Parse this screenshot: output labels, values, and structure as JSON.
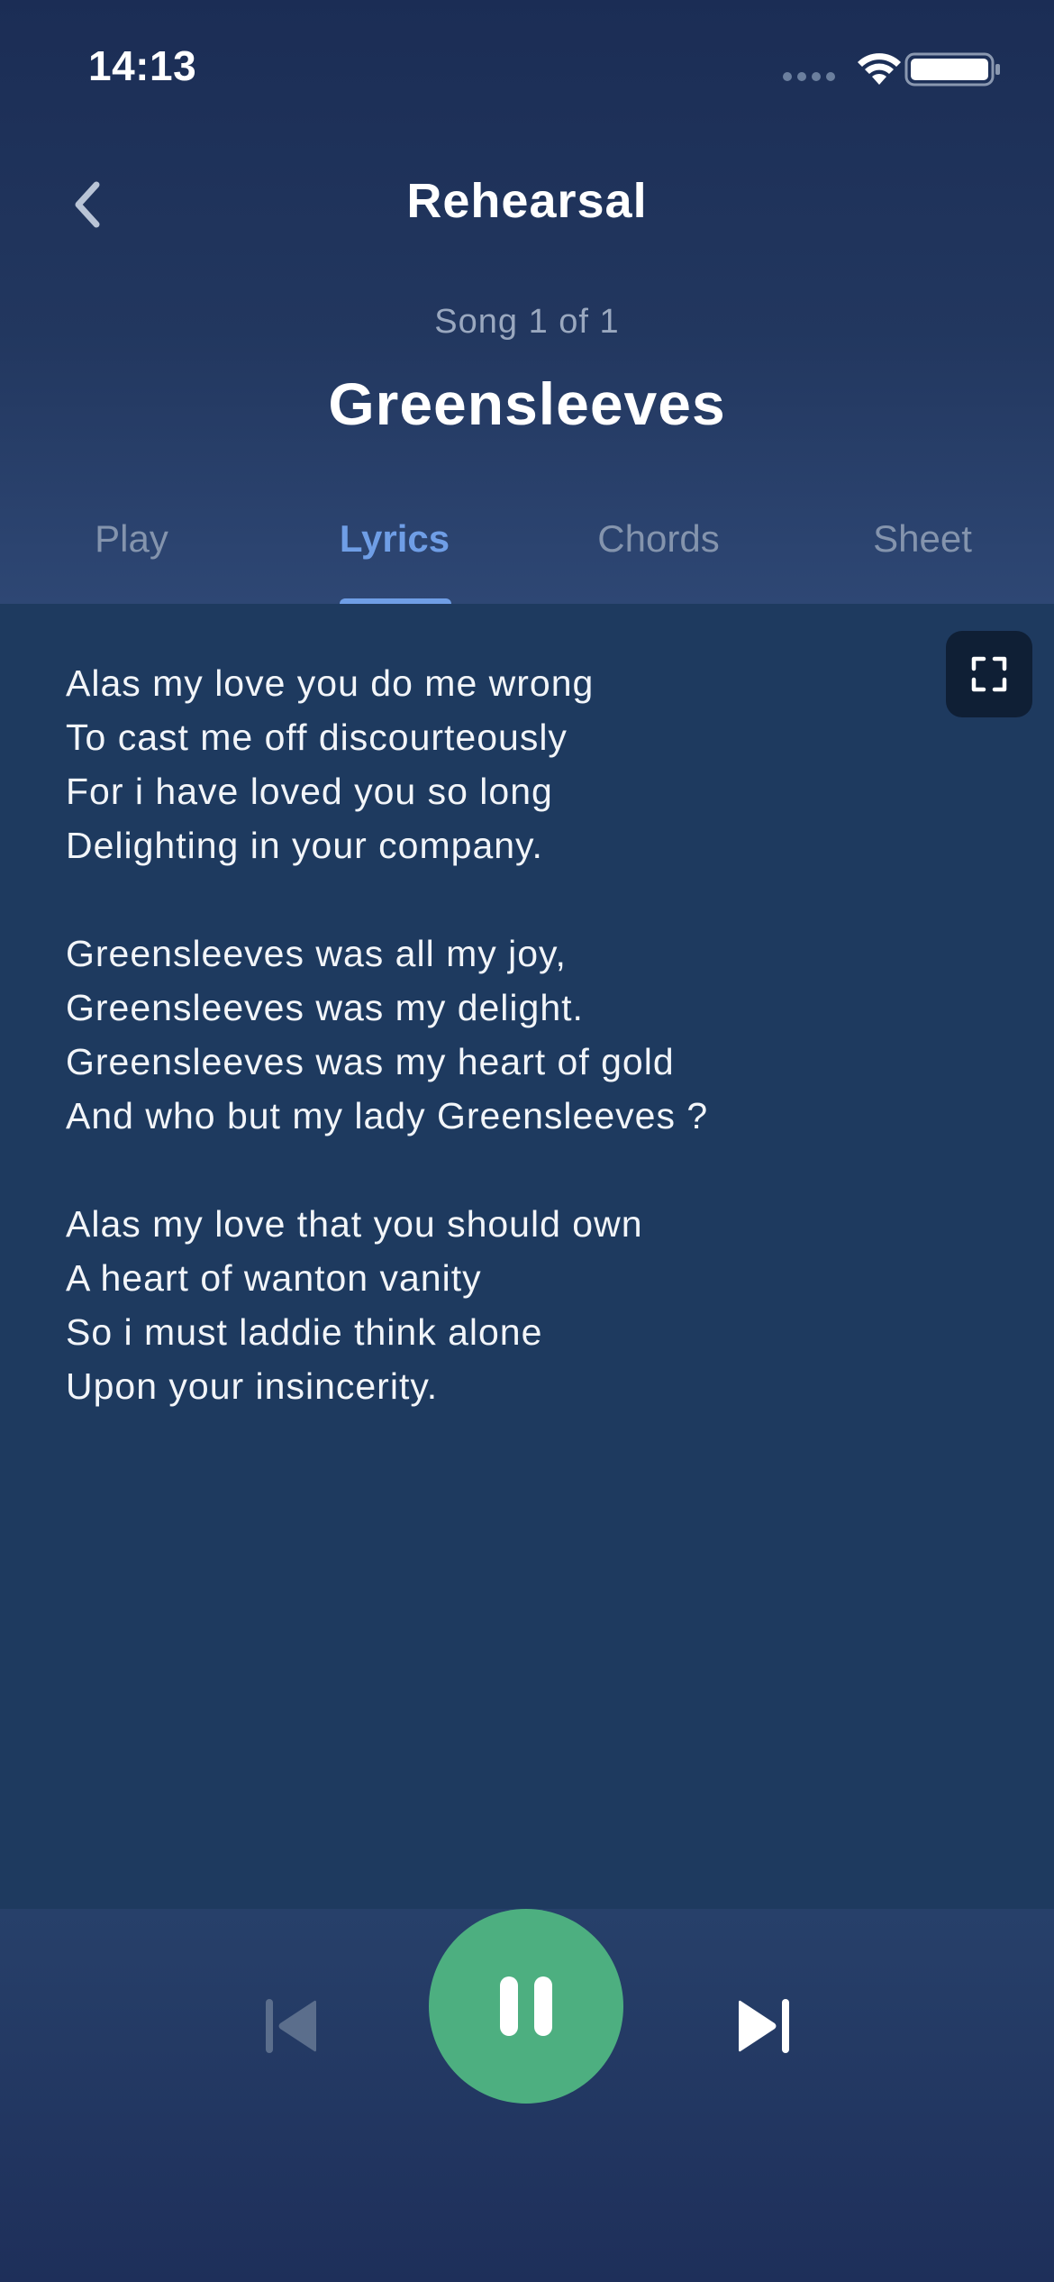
{
  "status_bar": {
    "time": "14:13",
    "icons": [
      "cellular-signal-icon",
      "wifi-icon",
      "battery-icon"
    ]
  },
  "nav": {
    "back_icon": "chevron-left-icon",
    "title": "Rehearsal"
  },
  "song": {
    "counter": "Song 1 of 1",
    "title": "Greensleeves"
  },
  "tabs": [
    {
      "label": "Play",
      "active": false
    },
    {
      "label": "Lyrics",
      "active": true
    },
    {
      "label": "Chords",
      "active": false
    },
    {
      "label": "Sheet",
      "active": false
    }
  ],
  "lyrics": {
    "fullscreen_icon": "fullscreen-icon",
    "stanzas": [
      {
        "lines": [
          "Alas my love you do me wrong",
          "To cast me off discourteously",
          "For i have loved you so long",
          "Delighting in your company."
        ]
      },
      {
        "lines": [
          "Greensleeves was all my joy,",
          "Greensleeves was my delight.",
          "Greensleeves was my heart of gold",
          "And who but my lady Greensleeves ?"
        ]
      },
      {
        "lines": [
          "Alas my love that you should own",
          "A heart of wanton vanity",
          "So i must laddie think alone",
          "Upon your insincerity."
        ]
      }
    ]
  },
  "player": {
    "prev_icon": "skip-previous-icon",
    "play_pause_icon": "pause-icon",
    "next_icon": "skip-next-icon",
    "prev_enabled": false,
    "accent_color": "#4daf80"
  },
  "colors": {
    "background": "#1e3a5f",
    "tab_active": "#6f9ee6",
    "tab_inactive": "#8494ad"
  }
}
